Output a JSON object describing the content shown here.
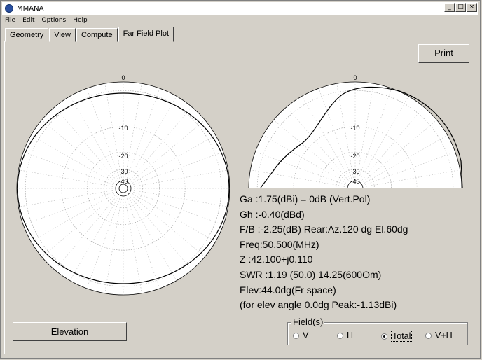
{
  "window": {
    "title": "MMANA",
    "controls": [
      "_",
      "□",
      "×"
    ]
  },
  "menu": [
    "File",
    "Edit",
    "Options",
    "Help"
  ],
  "tabs": [
    "Geometry",
    "View",
    "Compute",
    "Far Field Plot"
  ],
  "active_tab": "Far Field Plot",
  "print_label": "Print",
  "plot_labels": [
    "0",
    "-10",
    "-20",
    "-30",
    "-40"
  ],
  "info": {
    "ga": "Ga  :1.75(dBi) = 0dB  (Vert.Pol)",
    "gh": "Gh  :-0.40(dBd)",
    "fb": "F/B :-2.25(dB) Rear:Az.120 dg El.60dg",
    "freq": "Freq:50.500(MHz)",
    "z": "Z   :42.100+j0.110",
    "swr": "SWR :1.19 (50.0)  14.25(600Om)",
    "elev": "Elev:44.0dg(Fr space)",
    "peak": "(for elev angle 0.0dg Peak:-1.13dBi)"
  },
  "elevation_button": "Elevation",
  "field_group": {
    "legend": "Field(s)",
    "options": [
      "V",
      "H",
      "Total",
      "V+H"
    ],
    "selected": "Total"
  }
}
